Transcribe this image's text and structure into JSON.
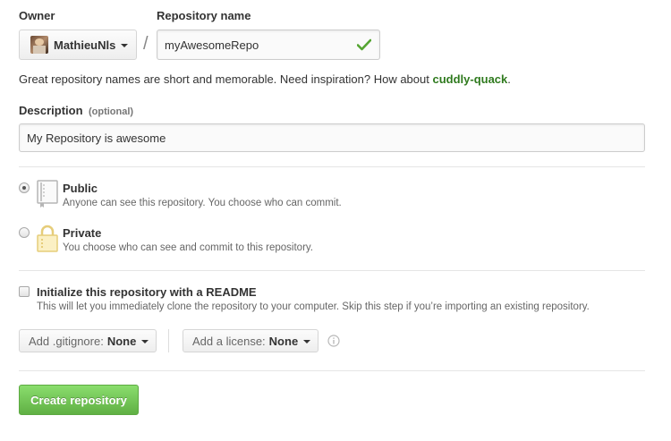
{
  "owner": {
    "label": "Owner",
    "selected": "MathieuNls"
  },
  "separator": "/",
  "repo_name": {
    "label": "Repository name",
    "value": "myAwesomeRepo",
    "valid_icon": "check-icon"
  },
  "hint": {
    "prefix": "Great repository names are short and memorable. Need inspiration? How about ",
    "suggestion": "cuddly-quack",
    "suffix": "."
  },
  "description": {
    "label": "Description",
    "optional": "(optional)",
    "value": "My Repository is awesome"
  },
  "visibility": {
    "options": [
      {
        "title": "Public",
        "desc": "Anyone can see this repository. You choose who can commit.",
        "icon": "repo-book-icon",
        "checked": true
      },
      {
        "title": "Private",
        "desc": "You choose who can see and commit to this repository.",
        "icon": "lock-icon",
        "checked": false
      }
    ]
  },
  "readme": {
    "title": "Initialize this repository with a README",
    "desc": "This will let you immediately clone the repository to your computer. Skip this step if you’re importing an existing repository.",
    "checked": false
  },
  "gitignore": {
    "prefix": "Add .gitignore:",
    "value": "None"
  },
  "license": {
    "prefix": "Add a license:",
    "value": "None",
    "info_icon": "info-icon"
  },
  "create_button": "Create repository",
  "colors": {
    "accent_green": "#2f7a1e",
    "check_green": "#55a532",
    "button_green_top": "#8add6d",
    "button_green_bottom": "#60b044"
  }
}
